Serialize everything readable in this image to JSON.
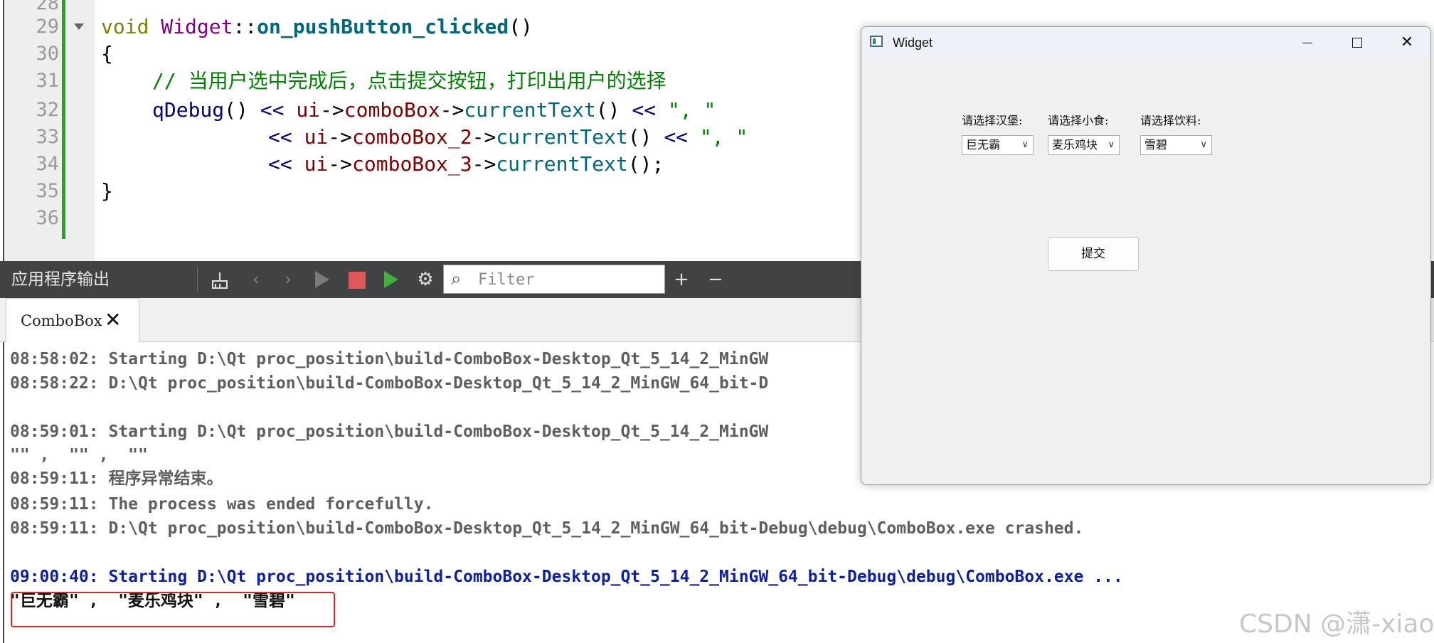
{
  "editor": {
    "lines": [
      {
        "no": "28",
        "text": ""
      },
      {
        "no": "29",
        "text": "void Widget::on_pushButton_clicked()"
      },
      {
        "no": "30",
        "text": "{"
      },
      {
        "no": "31",
        "text": "    // 当用户选中完成后，点击提交按钮，打印出用户的选择"
      },
      {
        "no": "32",
        "text": "    qDebug() << ui->comboBox->currentText() << \", \""
      },
      {
        "no": "33",
        "text": "             << ui->comboBox_2->currentText() << \", \""
      },
      {
        "no": "34",
        "text": "             << ui->comboBox_3->currentText();"
      },
      {
        "no": "35",
        "text": "}"
      },
      {
        "no": "36",
        "text": ""
      }
    ],
    "tokens": {
      "void": "void",
      "class_name": "Widget",
      "scope": "::",
      "method": "on_pushButton_clicked",
      "parens": "()",
      "brace_open": "{",
      "brace_close": "}",
      "comment": "// 当用户选中完成后，点击提交按钮，打印出用户的选择",
      "qdebug": "qDebug",
      "call": "()",
      "shift": "<<",
      "ui": "ui",
      "arrow": "->",
      "cb1": "comboBox",
      "cb2": "comboBox_2",
      "cb3": "comboBox_3",
      "current_text": "currentText",
      "sep_str": "\", \"",
      "semicolon": "();"
    }
  },
  "output_pane": {
    "title": "应用程序输出",
    "toolbar_icons": [
      "clean-icon",
      "prev-icon",
      "next-icon",
      "run-icon",
      "stop-icon",
      "debug-run-icon",
      "gear-icon",
      "zoom-in-icon",
      "zoom-out-icon"
    ],
    "filter_placeholder": "Filter",
    "tab_label": "ComboBox"
  },
  "log": {
    "lines": [
      {
        "text": "08:58:02: Starting D:\\Qt proc_position\\build-ComboBox-Desktop_Qt_5_14_2_MinGW",
        "style": "gray"
      },
      {
        "text": "08:58:22: D:\\Qt proc_position\\build-ComboBox-Desktop_Qt_5_14_2_MinGW_64_bit-D",
        "style": "gray"
      },
      {
        "text": "08:59:01: Starting D:\\Qt proc_position\\build-ComboBox-Desktop_Qt_5_14_2_MinGW",
        "style": "gray"
      },
      {
        "text": "\"\" ,  \"\" ,  \"\"",
        "style": "gray"
      },
      {
        "text": "08:59:11: 程序异常结束。",
        "style": "gray"
      },
      {
        "text": "08:59:11: The process was ended forcefully.",
        "style": "gray"
      },
      {
        "text": "08:59:11: D:\\Qt proc_position\\build-ComboBox-Desktop_Qt_5_14_2_MinGW_64_bit-Debug\\debug\\ComboBox.exe crashed.",
        "style": "gray"
      },
      {
        "text": "09:00:40: Starting D:\\Qt proc_position\\build-ComboBox-Desktop_Qt_5_14_2_MinGW_64_bit-Debug\\debug\\ComboBox.exe ...",
        "style": "blue"
      },
      {
        "text": "\"巨无霸\" ,  \"麦乐鸡块\" ,  \"雪碧\"",
        "style": "black"
      }
    ]
  },
  "watermark": "CSDN @潇-xiao",
  "widget_window": {
    "title": "Widget",
    "combos": [
      {
        "label": "请选择汉堡:",
        "value": "巨无霸"
      },
      {
        "label": "请选择小食:",
        "value": "麦乐鸡块"
      },
      {
        "label": "请选择饮料:",
        "value": "雪碧"
      }
    ],
    "submit_label": "提交"
  },
  "colors": {
    "keyword": "#808000",
    "class": "#800080",
    "function": "#00677c",
    "comment": "#008000",
    "member": "#800000",
    "operator": "#000080",
    "log_gray": "#5e5e5e",
    "log_blue": "#0b1fa8",
    "highlight_border": "#e0242b",
    "change_bar": "#22a822"
  }
}
